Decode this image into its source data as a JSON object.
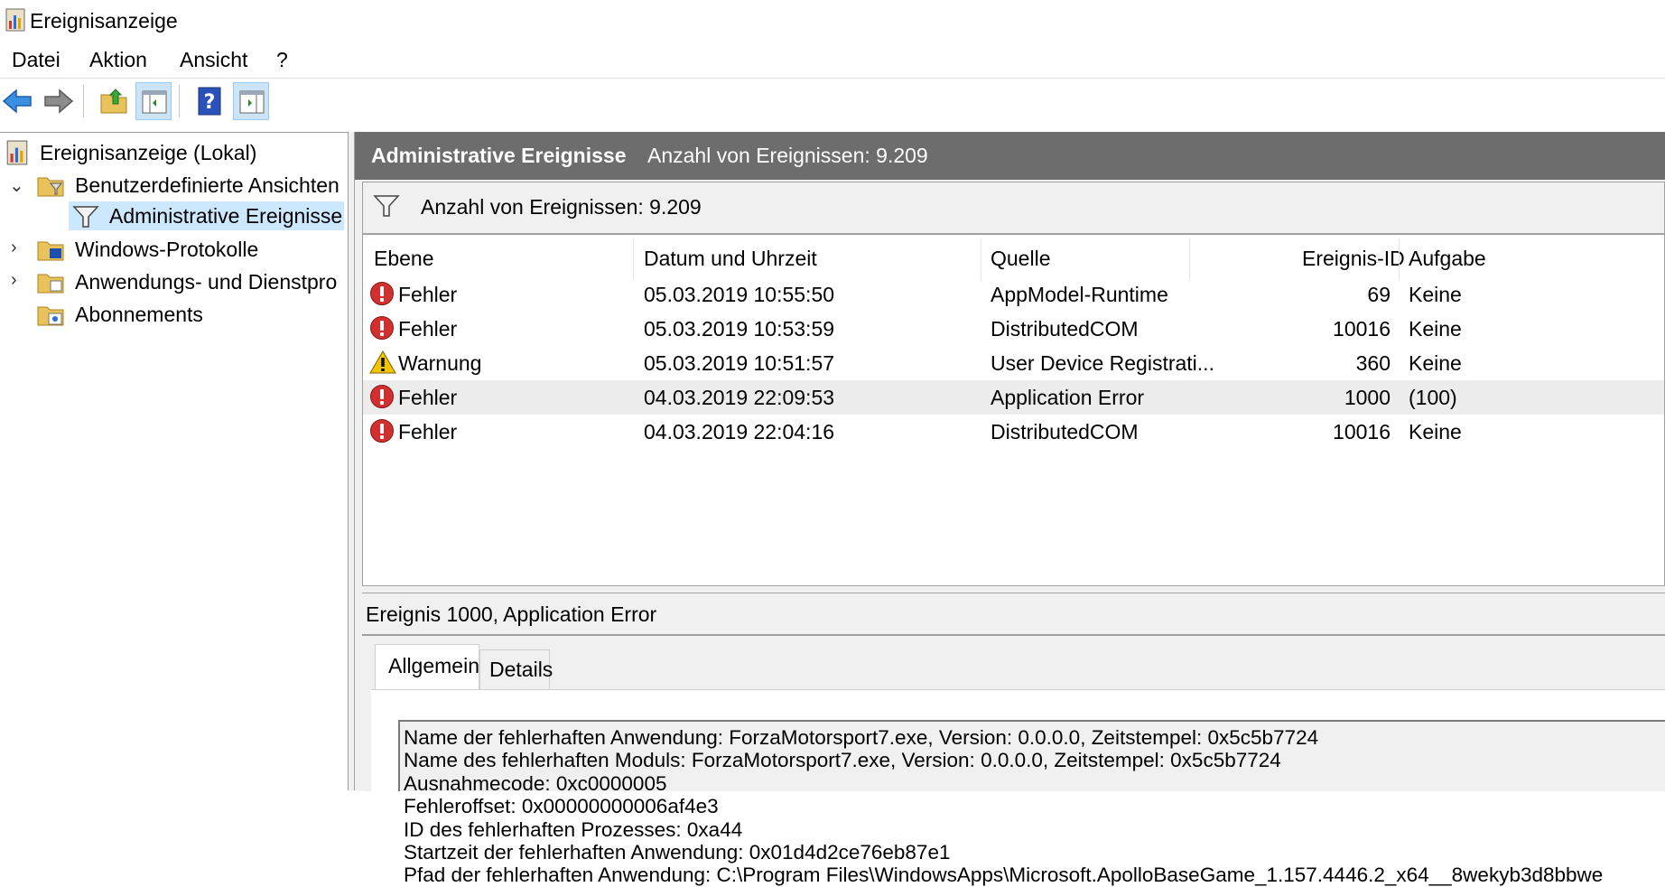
{
  "window": {
    "title": "Ereignisanzeige"
  },
  "menu": [
    "Datei",
    "Aktion",
    "Ansicht",
    "?"
  ],
  "toolbar": {
    "buttons": [
      "back-icon",
      "forward-icon",
      "up-folder-icon",
      "show-hide-console-tree-icon",
      "help-icon",
      "show-hide-action-pane-icon"
    ]
  },
  "tree": {
    "root": "Ereignisanzeige (Lokal)",
    "custom_views": "Benutzerdefinierte Ansichten",
    "admin_events": "Administrative Ereignisse",
    "windows_logs": "Windows-Protokolle",
    "app_service_logs": "Anwendungs- und Dienstpro",
    "subscriptions": "Abonnements"
  },
  "main": {
    "header_title": "Administrative Ereignisse",
    "header_count": "Anzahl von Ereignissen: 9.209",
    "filter_count": "Anzahl von Ereignissen: 9.209"
  },
  "grid": {
    "columns": [
      "Ebene",
      "Datum und Uhrzeit",
      "Quelle",
      "Ereignis-ID",
      "Aufgabe"
    ],
    "rows": [
      {
        "icon": "error-icon",
        "level": "Fehler",
        "datetime": "05.03.2019 10:55:50",
        "source": "AppModel-Runtime",
        "id": "69",
        "task": "Keine"
      },
      {
        "icon": "error-icon",
        "level": "Fehler",
        "datetime": "05.03.2019 10:53:59",
        "source": "DistributedCOM",
        "id": "10016",
        "task": "Keine"
      },
      {
        "icon": "warning-icon",
        "level": "Warnung",
        "datetime": "05.03.2019 10:51:57",
        "source": "User Device Registrati...",
        "id": "360",
        "task": "Keine"
      },
      {
        "icon": "error-icon",
        "level": "Fehler",
        "datetime": "04.03.2019 22:09:53",
        "source": "Application Error",
        "id": "1000",
        "task": "(100)"
      },
      {
        "icon": "error-icon",
        "level": "Fehler",
        "datetime": "04.03.2019 22:04:16",
        "source": "DistributedCOM",
        "id": "10016",
        "task": "Keine"
      }
    ]
  },
  "detail": {
    "title": "Ereignis 1000, Application Error",
    "tabs": [
      "Allgemein",
      "Details"
    ],
    "lines": [
      "Name der fehlerhaften Anwendung: ForzaMotorsport7.exe, Version: 0.0.0.0, Zeitstempel: 0x5c5b7724",
      "Name des fehlerhaften Moduls: ForzaMotorsport7.exe, Version: 0.0.0.0, Zeitstempel: 0x5c5b7724",
      "Ausnahmecode: 0xc0000005",
      "Fehleroffset: 0x00000000006af4e3",
      "ID des fehlerhaften Prozesses: 0xa44",
      "Startzeit der fehlerhaften Anwendung: 0x01d4d2ce76eb87e1",
      "Pfad der fehlerhaften Anwendung: C:\\Program Files\\WindowsApps\\Microsoft.ApolloBaseGame_1.157.4446.2_x64__8wekyb3d8bbwe"
    ]
  },
  "colors": {
    "header_bg": "#6d6d6d",
    "selection": "#cce8ff",
    "error": "#d32f2f",
    "warning": "#f5c400"
  }
}
